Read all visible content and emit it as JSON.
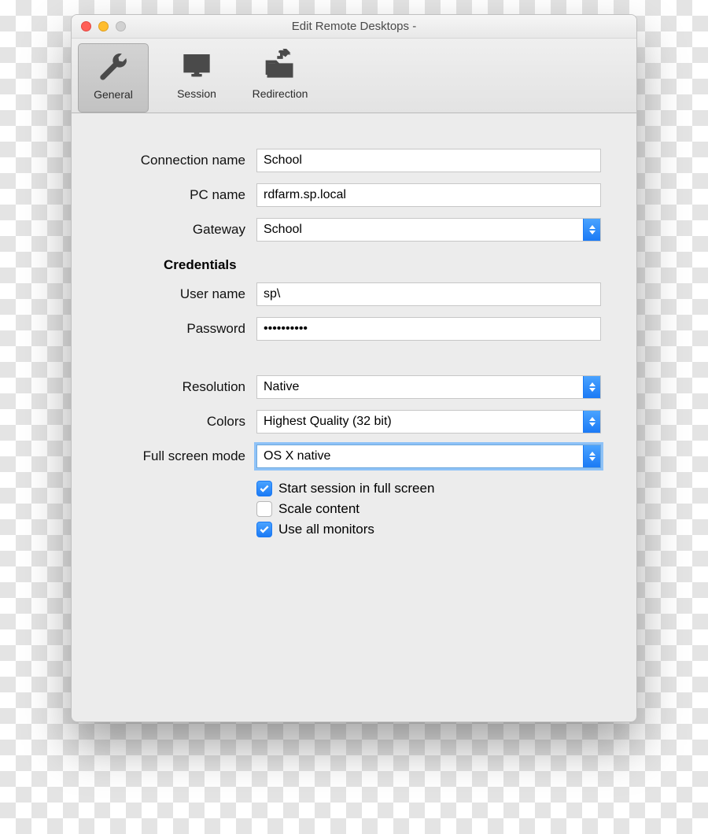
{
  "window": {
    "title": "Edit Remote Desktops -"
  },
  "toolbar": {
    "general": "General",
    "session": "Session",
    "redirection": "Redirection"
  },
  "labels": {
    "connection_name": "Connection name",
    "pc_name": "PC name",
    "gateway": "Gateway",
    "credentials": "Credentials",
    "user_name": "User name",
    "password": "Password",
    "resolution": "Resolution",
    "colors": "Colors",
    "full_screen_mode": "Full screen mode"
  },
  "values": {
    "connection_name": "School",
    "pc_name": "rdfarm.sp.local",
    "gateway": "School",
    "user_name": "sp\\",
    "password": "••••••••••",
    "resolution": "Native",
    "colors": "Highest Quality (32 bit)",
    "full_screen_mode": "OS X native"
  },
  "checkboxes": {
    "start_full_screen": {
      "label": "Start session in full screen",
      "checked": true
    },
    "scale_content": {
      "label": "Scale content",
      "checked": false
    },
    "use_all_monitors": {
      "label": "Use all monitors",
      "checked": true
    }
  }
}
